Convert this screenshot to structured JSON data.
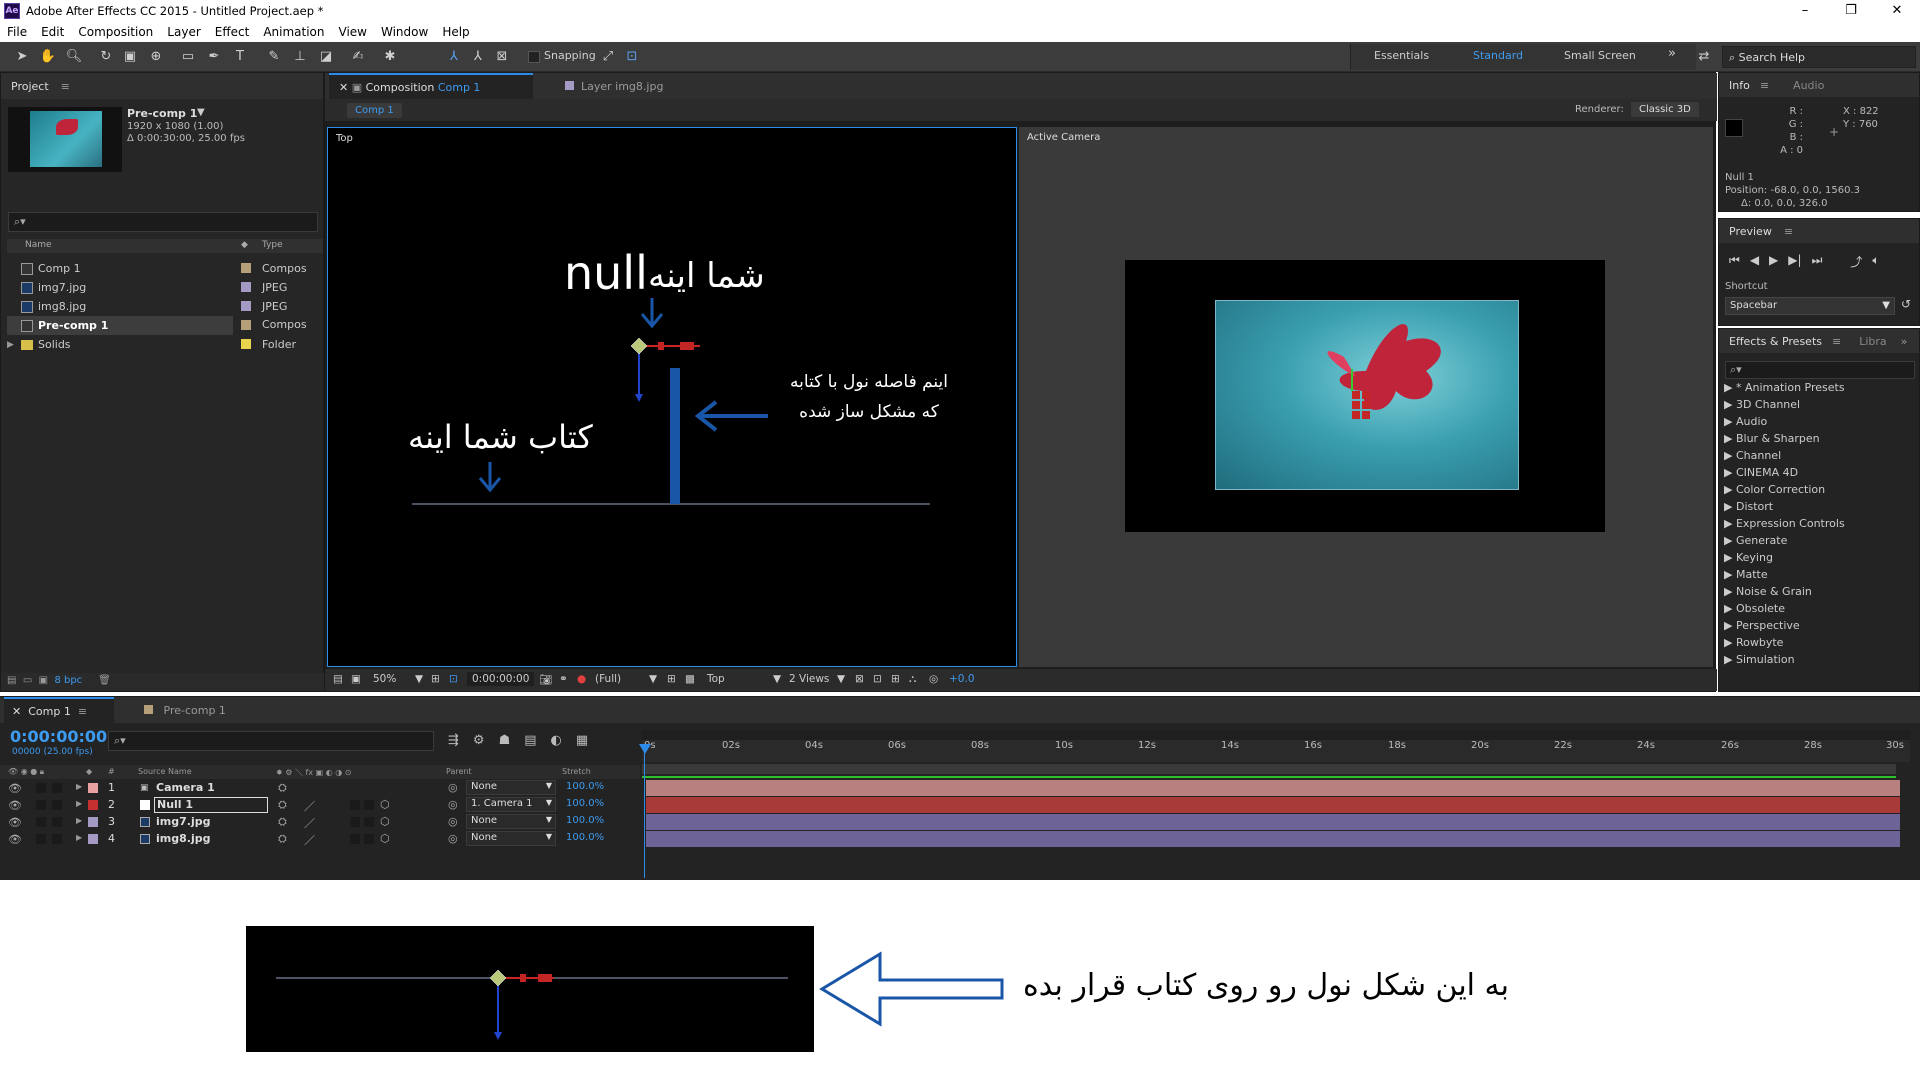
{
  "app": {
    "logo": "Ae",
    "title": "Adobe After Effects CC 2015 - Untitled Project.aep *",
    "window_controls": [
      "–",
      "❐",
      "✕"
    ]
  },
  "menu": [
    "File",
    "Edit",
    "Composition",
    "Layer",
    "Effect",
    "Animation",
    "View",
    "Window",
    "Help"
  ],
  "toolbar": {
    "snapping_label": "Snapping",
    "workspaces": [
      "Essentials",
      "Standard",
      "Small Screen"
    ],
    "active_workspace": "Standard",
    "search_help_placeholder": "Search Help"
  },
  "project": {
    "title": "Project",
    "thumb_name": "Pre-comp 1",
    "thumb_size": "1920 x 1080 (1.00)",
    "thumb_duration": "Δ 0:00:30:00, 25.00 fps",
    "col_name": "Name",
    "col_type": "Type",
    "items": [
      {
        "name": "Comp 1",
        "type": "Compos",
        "color": "#b5a07a"
      },
      {
        "name": "img7.jpg",
        "type": "JPEG",
        "color": "#a49ac4"
      },
      {
        "name": "img8.jpg",
        "type": "JPEG",
        "color": "#a49ac4"
      },
      {
        "name": "Pre-comp 1",
        "type": "Compos",
        "color": "#b5a07a"
      },
      {
        "name": "Solids",
        "type": "Folder",
        "color": "#e8d44d"
      }
    ],
    "bpc": "8 bpc"
  },
  "composition": {
    "tab_prefix": "Composition",
    "tab_name": "Comp 1",
    "layer_tab": "Layer img8.jpg",
    "breadcrumb": "Comp 1",
    "renderer_label": "Renderer:",
    "renderer_value": "Classic 3D",
    "view_left_label": "Top",
    "view_right_label": "Active Camera",
    "annot_null": "null",
    "annot_null_fa": "شما اینه",
    "annot_distance_line1": "اینم فاصله نول با کتابه",
    "annot_distance_line2": "که مشکل ساز شده",
    "annot_book": "کتاب شما اینه",
    "zoom": "50%",
    "timecode": "0:00:00:00",
    "resolution": "(Full)",
    "view_select": "Top",
    "views": "2 Views",
    "exposure": "+0.0"
  },
  "info": {
    "tab_info": "Info",
    "tab_audio": "Audio",
    "r": "R :",
    "g": "G :",
    "b": "B :",
    "a": "A : 0",
    "x": "X : 822",
    "y": "Y : 760",
    "layer": "Null 1",
    "position": "Position: -68.0, 0.0, 1560.3",
    "delta": "Δ: 0.0, 0.0, 326.0"
  },
  "preview": {
    "title": "Preview",
    "shortcut_label": "Shortcut",
    "shortcut_value": "Spacebar"
  },
  "effects": {
    "tab": "Effects & Presets",
    "tab2": "Libra",
    "items": [
      "* Animation Presets",
      "3D Channel",
      "Audio",
      "Blur & Sharpen",
      "Channel",
      "CINEMA 4D",
      "Color Correction",
      "Distort",
      "Expression Controls",
      "Generate",
      "Keying",
      "Matte",
      "Noise & Grain",
      "Obsolete",
      "Perspective",
      "Rowbyte",
      "Simulation"
    ]
  },
  "timeline": {
    "tab_active": "Comp 1",
    "tab_other": "Pre-comp 1",
    "timecode": "0:00:00:00",
    "frame": "00000 (25.00 fps)",
    "col_source": "Source Name",
    "col_parent": "Parent",
    "col_stretch": "Stretch",
    "layers": [
      {
        "num": "1",
        "name": "Camera 1",
        "parent": "None",
        "stretch": "100.0%",
        "color": "#e8a0a0"
      },
      {
        "num": "2",
        "name": "Null 1",
        "parent": "1. Camera 1",
        "stretch": "100.0%",
        "color": "#c43030"
      },
      {
        "num": "3",
        "name": "img7.jpg",
        "parent": "None",
        "stretch": "100.0%",
        "color": "#a49ac4"
      },
      {
        "num": "4",
        "name": "img8.jpg",
        "parent": "None",
        "stretch": "100.0%",
        "color": "#a49ac4"
      }
    ],
    "ticks": [
      "0s",
      "02s",
      "04s",
      "06s",
      "08s",
      "10s",
      "12s",
      "14s",
      "16s",
      "18s",
      "20s",
      "22s",
      "24s",
      "26s",
      "28s",
      "30s"
    ]
  },
  "bottom": {
    "instruction": "به این شکل نول رو روی کتاب قرار بده"
  },
  "colors": {
    "accent_blue": "#2d8ceb",
    "annotation_blue": "#1a56a8",
    "null_red": "#c42525"
  }
}
